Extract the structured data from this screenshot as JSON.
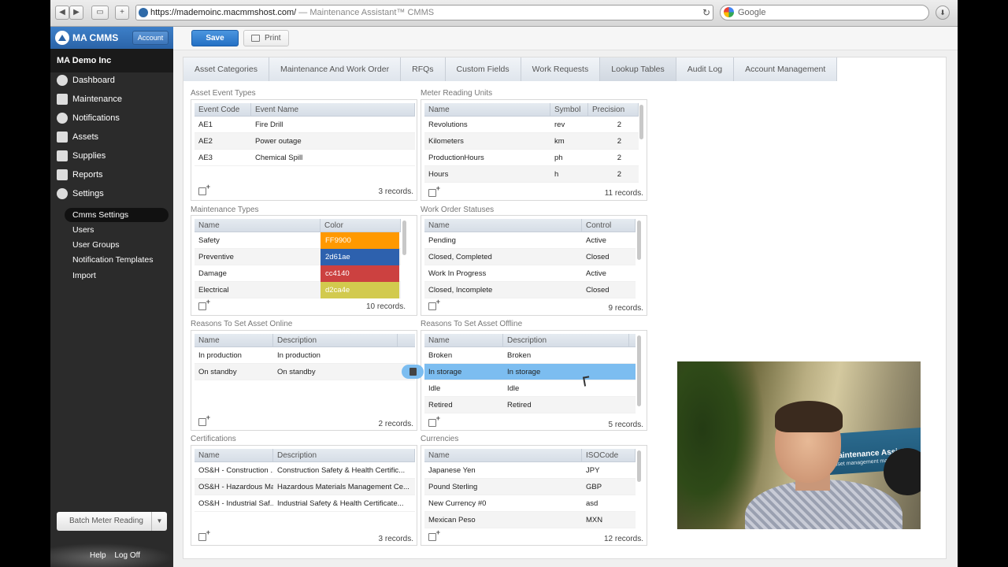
{
  "browser": {
    "url": "https://mademoinc.macmmshost.com/",
    "page_title": "— Maintenance Assistant™ CMMS",
    "search_engine": "Google",
    "back_glyph": "◀",
    "forward_glyph": "▶",
    "new_tab_glyph": "+",
    "reload_glyph": "↻",
    "download_glyph": "⬇"
  },
  "sidebar": {
    "app_name": "MA CMMS",
    "account_button": "Account",
    "company": "MA Demo Inc",
    "nav": [
      {
        "label": "Dashboard",
        "icon": "dashboard-icon"
      },
      {
        "label": "Maintenance",
        "icon": "wrench-icon"
      },
      {
        "label": "Notifications",
        "icon": "speech-bubble-icon"
      },
      {
        "label": "Assets",
        "icon": "boxes-icon"
      },
      {
        "label": "Supplies",
        "icon": "cart-icon"
      },
      {
        "label": "Reports",
        "icon": "chart-icon"
      },
      {
        "label": "Settings",
        "icon": "gear-icon"
      }
    ],
    "settings_subnav": [
      {
        "label": "Cmms Settings",
        "active": true
      },
      {
        "label": "Users",
        "active": false
      },
      {
        "label": "User Groups",
        "active": false
      },
      {
        "label": "Notification Templates",
        "active": false
      },
      {
        "label": "Import",
        "active": false
      }
    ],
    "batch_button": "Batch Meter Reading",
    "batch_dropdown_glyph": "▼",
    "footer_links": [
      "Help",
      "Log Off"
    ]
  },
  "toolbar": {
    "save_label": "Save",
    "print_label": "Print"
  },
  "tabs": [
    {
      "label": "Asset Categories",
      "active": false
    },
    {
      "label": "Maintenance And Work Order",
      "active": false
    },
    {
      "label": "RFQs",
      "active": false
    },
    {
      "label": "Custom Fields",
      "active": false
    },
    {
      "label": "Work Requests",
      "active": false
    },
    {
      "label": "Lookup Tables",
      "active": true
    },
    {
      "label": "Audit Log",
      "active": false
    },
    {
      "label": "Account Management",
      "active": false
    }
  ],
  "grids": {
    "asset_event_types": {
      "title": "Asset Event Types",
      "columns": [
        "Event Code",
        "Event Name"
      ],
      "rows": [
        [
          "AE1",
          "Fire Drill"
        ],
        [
          "AE2",
          "Power outage"
        ],
        [
          "AE3",
          "Chemical Spill"
        ]
      ],
      "records": "3 records."
    },
    "meter_reading_units": {
      "title": "Meter Reading Units",
      "columns": [
        "Name",
        "Symbol",
        "Precision"
      ],
      "rows": [
        [
          "Revolutions",
          "rev",
          "2"
        ],
        [
          "Kilometers",
          "km",
          "2"
        ],
        [
          "ProductionHours",
          "ph",
          "2"
        ],
        [
          "Hours",
          "h",
          "2"
        ]
      ],
      "records": "11 records."
    },
    "maintenance_types": {
      "title": "Maintenance Types",
      "columns": [
        "Name",
        "Color"
      ],
      "rows": [
        [
          "Safety",
          "FF9900"
        ],
        [
          "Preventive",
          "2d61ae"
        ],
        [
          "Damage",
          "cc4140"
        ],
        [
          "Electrical",
          "d2ca4e"
        ]
      ],
      "swatch_colors": [
        "#FF9900",
        "#2d61ae",
        "#cc4140",
        "#d2ca4e"
      ],
      "records": "10 records."
    },
    "work_order_statuses": {
      "title": "Work Order Statuses",
      "columns": [
        "Name",
        "Control"
      ],
      "rows": [
        [
          "Pending",
          "Active"
        ],
        [
          "Closed, Completed",
          "Closed"
        ],
        [
          "Work In Progress",
          "Active"
        ],
        [
          "Closed, Incomplete",
          "Closed"
        ]
      ],
      "records": "9 records."
    },
    "reasons_online": {
      "title": "Reasons To Set Asset Online",
      "columns": [
        "Name",
        "Description"
      ],
      "rows": [
        [
          "In production",
          "In production"
        ],
        [
          "On standby",
          "On standby"
        ]
      ],
      "records": "2 records."
    },
    "reasons_offline": {
      "title": "Reasons To Set Asset Offline",
      "columns": [
        "Name",
        "Description"
      ],
      "rows": [
        [
          "Broken",
          "Broken"
        ],
        [
          "In storage",
          "In storage"
        ],
        [
          "Idle",
          "Idle"
        ],
        [
          "Retired",
          "Retired"
        ]
      ],
      "selected_row": 1,
      "records": "5 records."
    },
    "certifications": {
      "title": "Certifications",
      "columns": [
        "Name",
        "Description"
      ],
      "rows": [
        [
          "OS&H - Construction ...",
          "Construction Safety & Health Certific..."
        ],
        [
          "OS&H - Hazardous Ma...",
          "Hazardous Materials Management Ce..."
        ],
        [
          "OS&H - Industrial Saf...",
          "Industrial Safety & Health Certificate..."
        ]
      ],
      "records": "3 records."
    },
    "currencies": {
      "title": "Currencies",
      "columns": [
        "Name",
        "ISOCode"
      ],
      "rows": [
        [
          "Japanese Yen",
          "JPY"
        ],
        [
          "Pound Sterling",
          "GBP"
        ],
        [
          "New Currency #0",
          "asd"
        ],
        [
          "Mexican Peso",
          "MXN"
        ]
      ],
      "records": "12 records."
    }
  },
  "webcam": {
    "sign_text": "Maintenance Assist",
    "sign_subtext": "asset management made"
  }
}
